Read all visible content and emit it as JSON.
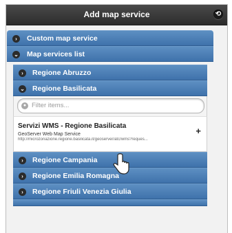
{
  "header": {
    "title": "Add map service",
    "close_glyph": "⟲",
    "close_icon": "refresh-icon"
  },
  "outer_sections": [
    {
      "label": "Custom map service",
      "state": "collapsed"
    },
    {
      "label": "Map services list",
      "state": "expanded"
    }
  ],
  "regions": [
    {
      "label": "Regione Abruzzo",
      "state": "collapsed"
    },
    {
      "label": "Regione Basilicata",
      "state": "expanded"
    },
    {
      "label": "Regione Campania",
      "state": "collapsed"
    },
    {
      "label": "Regione Emilia Romagna",
      "state": "collapsed"
    },
    {
      "label": "Regione Friuli Venezia Giulia",
      "state": "collapsed"
    }
  ],
  "filter": {
    "placeholder": "Filter items..."
  },
  "service": {
    "title": "Servizi WMS - Regione Basilicata",
    "subtitle": "GeoServer Web Map Service",
    "url": "http://microzonazione.regione.basilicata.it/geoserver/atc/wms?reques...",
    "add_glyph": "+"
  },
  "glyphs": {
    "collapsed": "›",
    "expanded": "⌄"
  },
  "colors": {
    "header_bg": "#333333",
    "bar_bg": "#4a7db5",
    "page_bg": "#f2f2f2"
  }
}
